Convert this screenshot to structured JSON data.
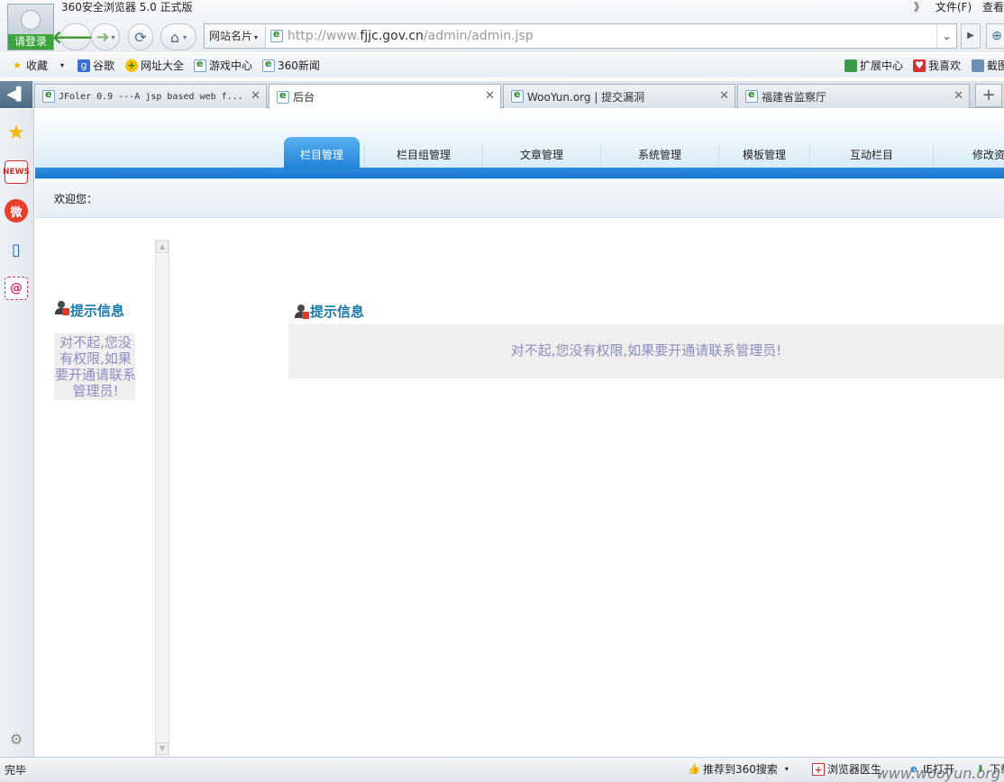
{
  "browser": {
    "app_title": "360安全浏览器 5.0 正式版",
    "login_label": "请登录",
    "menu_right": [
      "》",
      "文件(F)",
      "查看"
    ],
    "site_card_label": "网站名片",
    "url_prefix": "http://www.",
    "url_domain": "fjjc.gov.cn",
    "url_path": "/admin/admin.jsp"
  },
  "bookmarks": {
    "left": [
      {
        "label": "收藏",
        "icon": "star-icon"
      },
      {
        "label": "谷歌",
        "icon": "google-icon"
      },
      {
        "label": "网址大全",
        "icon": "site-nav-icon"
      },
      {
        "label": "游戏中心",
        "icon": "ie-page-icon"
      },
      {
        "label": "360新闻",
        "icon": "ie-page-icon"
      }
    ],
    "right": [
      {
        "label": "扩展中心",
        "icon": "extension-cube-icon"
      },
      {
        "label": "我喜欢",
        "icon": "heart-icon"
      },
      {
        "label": "截图",
        "icon": "screenshot-icon"
      }
    ]
  },
  "tabs": [
    {
      "label": "JFoler 0.9 ---A jsp based web f...",
      "active": false
    },
    {
      "label": "后台",
      "active": true
    },
    {
      "label": "WooYun.org | 提交漏洞",
      "active": false
    },
    {
      "label": "福建省监察厅",
      "active": false
    }
  ],
  "site": {
    "nav": [
      "栏目管理",
      "栏目组管理",
      "文章管理",
      "系统管理",
      "模板管理",
      "互动栏目",
      "修改资"
    ],
    "welcome": "欢迎您：",
    "left_title": "提示信息",
    "left_message": "对不起,您没有权限,如果要开通请联系管理员!",
    "main_title": "提示信息",
    "main_message": "对不起,您没有权限,如果要开通请联系管理员!"
  },
  "status": {
    "text": "完毕",
    "items": [
      "推荐到360搜索",
      "浏览器医生",
      "IE打开",
      "下载"
    ],
    "watermark": "www.wooyun.org"
  },
  "colors": {
    "nav_blue": "#1f81d6",
    "prompt_title": "#1a7aa5",
    "message_text": "#8e8ec0",
    "message_bg": "#efefef"
  }
}
